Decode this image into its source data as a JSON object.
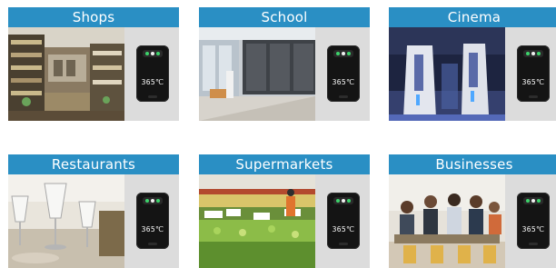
{
  "tiles": [
    {
      "id": "shops",
      "label": "Shops",
      "reading": "365℃"
    },
    {
      "id": "school",
      "label": "School",
      "reading": "365℃"
    },
    {
      "id": "cinema",
      "label": "Cinema",
      "reading": "365℃"
    },
    {
      "id": "restaurants",
      "label": "Restaurants",
      "reading": "365℃"
    },
    {
      "id": "supermarkets",
      "label": "Supermarkets",
      "reading": "365℃"
    },
    {
      "id": "businesses",
      "label": "Businesses",
      "reading": "365℃"
    }
  ],
  "colors": {
    "title_bar": "#2a8fc4",
    "tile_background": "#dcdcdc",
    "device_body": "#141414"
  },
  "icons": {
    "device": "thermometer-device-icon"
  }
}
